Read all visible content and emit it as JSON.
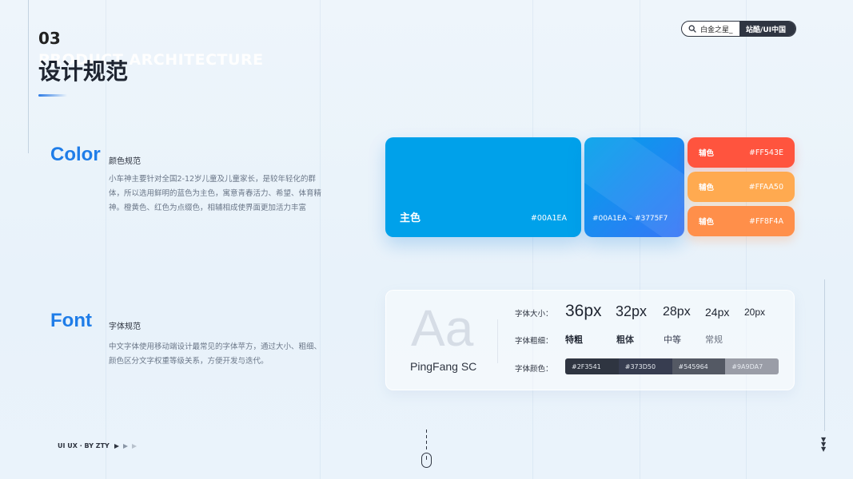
{
  "section": {
    "number": "03",
    "english_title": "PRODUCT ARCHITECTURE",
    "title": "设计规范"
  },
  "search": {
    "text": "白金之星_",
    "button": "站酷/UI中国"
  },
  "color_section": {
    "heading": "Color",
    "subheading": "颜色规范",
    "description": "小车神主要针对全国2-12岁儿童及儿童家长，是较年轻化的群体，所以选用鲜明的蓝色为主色，寓意青春活力、希望、体育精神。橙黄色、红色为点缀色，相辅相成使界面更加活力丰富",
    "main": {
      "label": "主色",
      "hex": "#00A1EA",
      "color": "#00A1EA"
    },
    "gradient": {
      "hex": "#00A1EA  –  #3775F7",
      "from": "#00A1EA",
      "to": "#3775F7"
    },
    "auxiliary": [
      {
        "label": "辅色",
        "hex": "#FF543E",
        "color": "#FF543E"
      },
      {
        "label": "辅色",
        "hex": "#FFAA50",
        "color": "#FFAA50"
      },
      {
        "label": "辅色",
        "hex": "#FF8F4A",
        "color": "#FF8F4A"
      }
    ]
  },
  "font_section": {
    "heading": "Font",
    "subheading": "字体规范",
    "description": "中文字体使用移动端设计最常见的字体苹方，通过大小、粗细、颜色区分文字权重等级关系，方便开发与迭代。",
    "sample": "Aa",
    "font_name": "PingFang SC",
    "size_label": "字体大小：",
    "sizes": [
      "36px",
      "32px",
      "28px",
      "24px",
      "20px"
    ],
    "weight_label": "字体粗细：",
    "weights": [
      "特粗",
      "粗体",
      "中等",
      "常规"
    ],
    "color_label": "字体颜色：",
    "colors": [
      {
        "hex": "#2F3541",
        "color": "#2F3541"
      },
      {
        "hex": "#373D50",
        "color": "#373D50"
      },
      {
        "hex": "#545964",
        "color": "#545964"
      },
      {
        "hex": "#9A9DA7",
        "color": "#9A9DA7"
      }
    ]
  },
  "footer": {
    "brand": "UI UX · BY ZTY"
  },
  "icons": [
    "search-icon",
    "play-arrows-icon",
    "mouse-scroll-icon",
    "chevron-down-icon"
  ]
}
